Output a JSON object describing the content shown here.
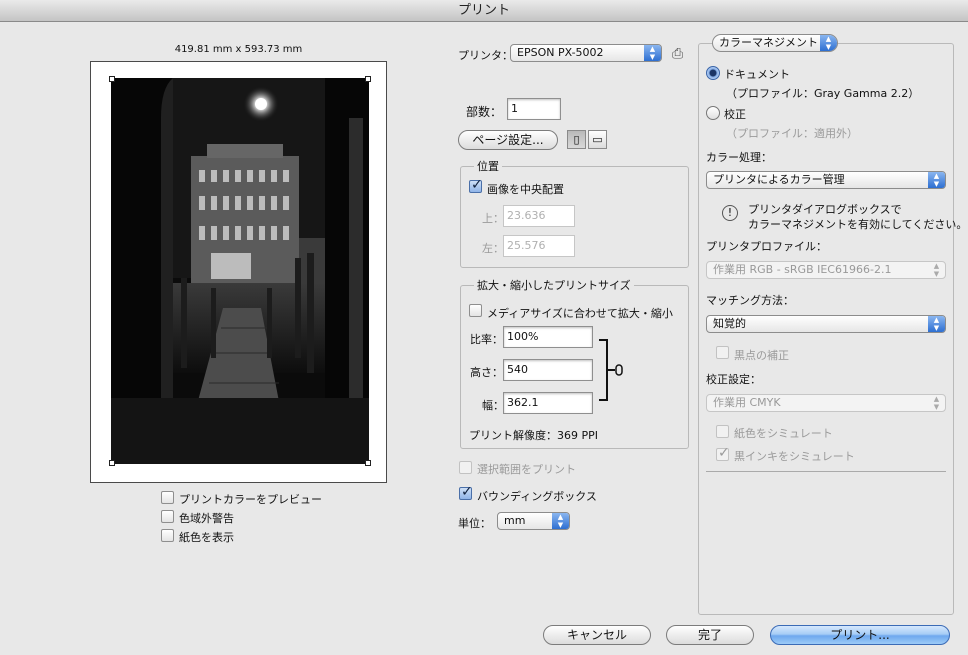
{
  "window": {
    "title": "プリント"
  },
  "preview": {
    "dimensions": "419.81 mm x 593.73 mm",
    "checkboxes": {
      "print_color_preview": {
        "label": "プリントカラーをプレビュー",
        "checked": false
      },
      "gamut_warning": {
        "label": "色域外警告",
        "checked": false
      },
      "show_paper_color": {
        "label": "紙色を表示",
        "checked": false
      }
    }
  },
  "printer": {
    "label": "プリンタ：",
    "value": "EPSON PX-5002"
  },
  "copies": {
    "label": "部数：",
    "value": "1"
  },
  "page_setup": {
    "label": "ページ設定..."
  },
  "position": {
    "title": "位置",
    "center_image": {
      "label": "画像を中央配置",
      "checked": true
    },
    "top": {
      "label": "上：",
      "value": "23.636"
    },
    "left": {
      "label": "左：",
      "value": "25.576"
    }
  },
  "scaled_print_size": {
    "title": "拡大・縮小したプリントサイズ",
    "scale_to_fit": {
      "label": "メディアサイズに合わせて拡大・縮小",
      "checked": false
    },
    "scale": {
      "label": "比率：",
      "value": "100%"
    },
    "height": {
      "label": "高さ：",
      "value": "540"
    },
    "width": {
      "label": "幅：",
      "value": "362.1"
    },
    "resolution": "プリント解像度：369 PPI"
  },
  "print_selected_area": {
    "label": "選択範囲をプリント",
    "checked": false
  },
  "bounding_box": {
    "label": "バウンディングボックス",
    "checked": true
  },
  "units": {
    "label": "単位：",
    "value": "mm"
  },
  "color_management": {
    "popup": "カラーマネジメント",
    "document": {
      "label": "ドキュメント",
      "profile": "（プロファイル：Gray Gamma 2.2）",
      "selected": true
    },
    "proof": {
      "label": "校正",
      "profile": "（プロファイル：適用外）",
      "selected": false
    },
    "color_handling": {
      "label": "カラー処理：",
      "value": "プリンタによるカラー管理"
    },
    "notice_line1": "プリンタダイアログボックスで",
    "notice_line2": "カラーマネジメントを有効にしてください。",
    "printer_profile": {
      "label": "プリンタプロファイル：",
      "value": "作業用 RGB - sRGB IEC61966-2.1"
    },
    "rendering_intent": {
      "label": "マッチング方法：",
      "value": "知覚的"
    },
    "black_point": {
      "label": "黒点の補正",
      "checked": false
    },
    "proof_setup": {
      "label": "校正設定：",
      "value": "作業用 CMYK"
    },
    "simulate_paper": {
      "label": "紙色をシミュレート",
      "checked": false
    },
    "simulate_black_ink": {
      "label": "黒インキをシミュレート",
      "checked": true
    }
  },
  "buttons": {
    "cancel": "キャンセル",
    "done": "完了",
    "print": "プリント..."
  }
}
